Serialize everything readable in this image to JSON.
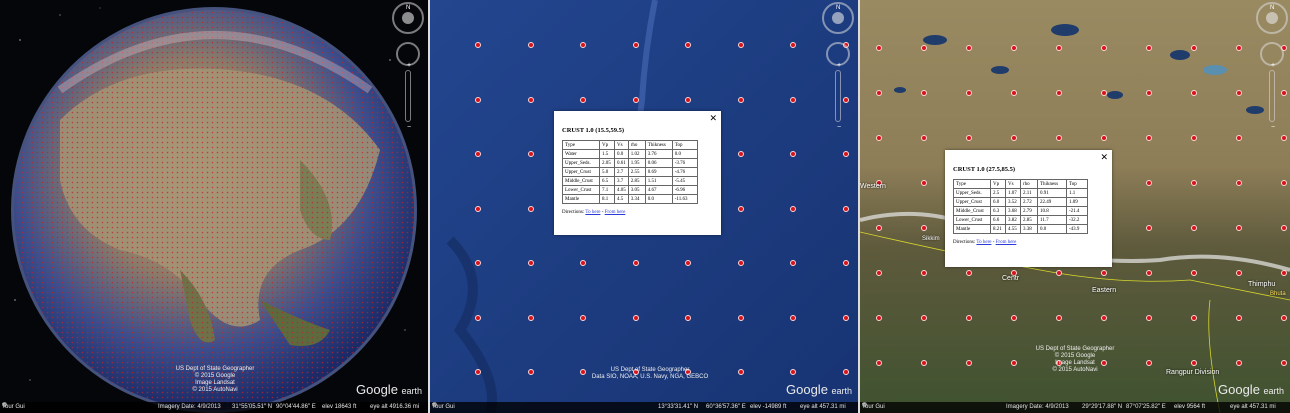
{
  "panels": [
    {
      "status": {
        "tour": "Tour Gui",
        "imagery_date": "Imagery Date: 4/9/2013",
        "lat": "31°55'05.51\" N",
        "lon": "90°04'44.86\" E",
        "elev": "elev 18643 ft",
        "eye_alt": "eye alt 4916.36 mi"
      },
      "credits": [
        "US Dept of State Geographer",
        "© 2015 Google",
        "Image Landsat",
        "© 2015 AutoNavi"
      ],
      "logo": "Google",
      "logo_suffix": "earth"
    },
    {
      "status": {
        "tour": "Tour Gui",
        "imagery_date": "",
        "lat": "13°33'31.41\" N",
        "lon": "60°36'57.36\" E",
        "elev": "elev -14989 ft",
        "eye_alt": "eye alt 457.31 mi"
      },
      "credits": [
        "US Dept of State Geographer",
        "Data SIO, NOAA, U.S. Navy, NGA, GEBCO"
      ],
      "logo": "Google",
      "logo_suffix": "earth",
      "popup": {
        "title": "CRUST 1.0 (15.5,59.5)",
        "headers": [
          "Type",
          "Vp",
          "Vs",
          "rho",
          "Thikness",
          "Top"
        ],
        "rows": [
          [
            "Water",
            "1.5",
            "0.0",
            "1.02",
            "3.76",
            "0.0"
          ],
          [
            "Upper_Seds.",
            "2.05",
            "0.61",
            "1.95",
            "0.06",
            "-3.76"
          ],
          [
            "Upper_Crust",
            "5.0",
            "2.7",
            "2.55",
            "0.69",
            "-4.76"
          ],
          [
            "Middle_Crust",
            "6.5",
            "3.7",
            "2.85",
            "1.51",
            "-5.45"
          ],
          [
            "Lower_Crust",
            "7.1",
            "4.05",
            "3.05",
            "4.67",
            "-6.96"
          ],
          [
            "Mantle",
            "8.1",
            "4.5",
            "3.34",
            "0.0",
            "-11.63"
          ]
        ],
        "directions_label": "Directions:",
        "to_here": "To here",
        "separator": " - ",
        "from_here": "From here",
        "close": "✕"
      }
    },
    {
      "status": {
        "tour": "Tour Gui",
        "imagery_date": "Imagery Date: 4/9/2013",
        "lat": "29°29'17.88\" N",
        "lon": "87°07'25.82\" E",
        "elev": "elev 9564 ft",
        "eye_alt": "eye alt 457.31 mi"
      },
      "credits": [
        "US Dept of State Geographer",
        "© 2015 Google",
        "Image Landsat",
        "© 2015 AutoNavi"
      ],
      "logo": "Google",
      "logo_suffix": "earth",
      "labels": [
        "Western",
        "Sikkim",
        "Centr",
        "Eastern",
        "Thimphu",
        "Bhuta",
        "Rangpur Division"
      ],
      "popup": {
        "title": "CRUST 1.0 (27.5,85.5)",
        "headers": [
          "Type",
          "Vp",
          "Vs",
          "rho",
          "Thikness",
          "Top"
        ],
        "rows": [
          [
            "Upper_Seds.",
            "2.5",
            "1.07",
            "2.11",
            "0.91",
            "1.1"
          ],
          [
            "Upper_Crust",
            "6.0",
            "3.52",
            "2.72",
            "22.49",
            "1.09"
          ],
          [
            "Middle_Crust",
            "6.3",
            "3.68",
            "2.79",
            "10.8",
            "-21.4"
          ],
          [
            "Lower_Crust",
            "6.6",
            "3.82",
            "2.85",
            "11.7",
            "-32.2"
          ],
          [
            "Mantle",
            "8.21",
            "4.55",
            "3.38",
            "0.0",
            "-43.9"
          ]
        ],
        "directions_label": "Directions:",
        "to_here": "To here",
        "separator": " - ",
        "from_here": "From here",
        "close": "✕"
      }
    }
  ],
  "nav": {
    "north": "N",
    "plus": "+",
    "minus": "−"
  },
  "colors": {
    "marker": "#d8131b",
    "ocean": "#1b3c86",
    "terrain": "#7b7452"
  }
}
